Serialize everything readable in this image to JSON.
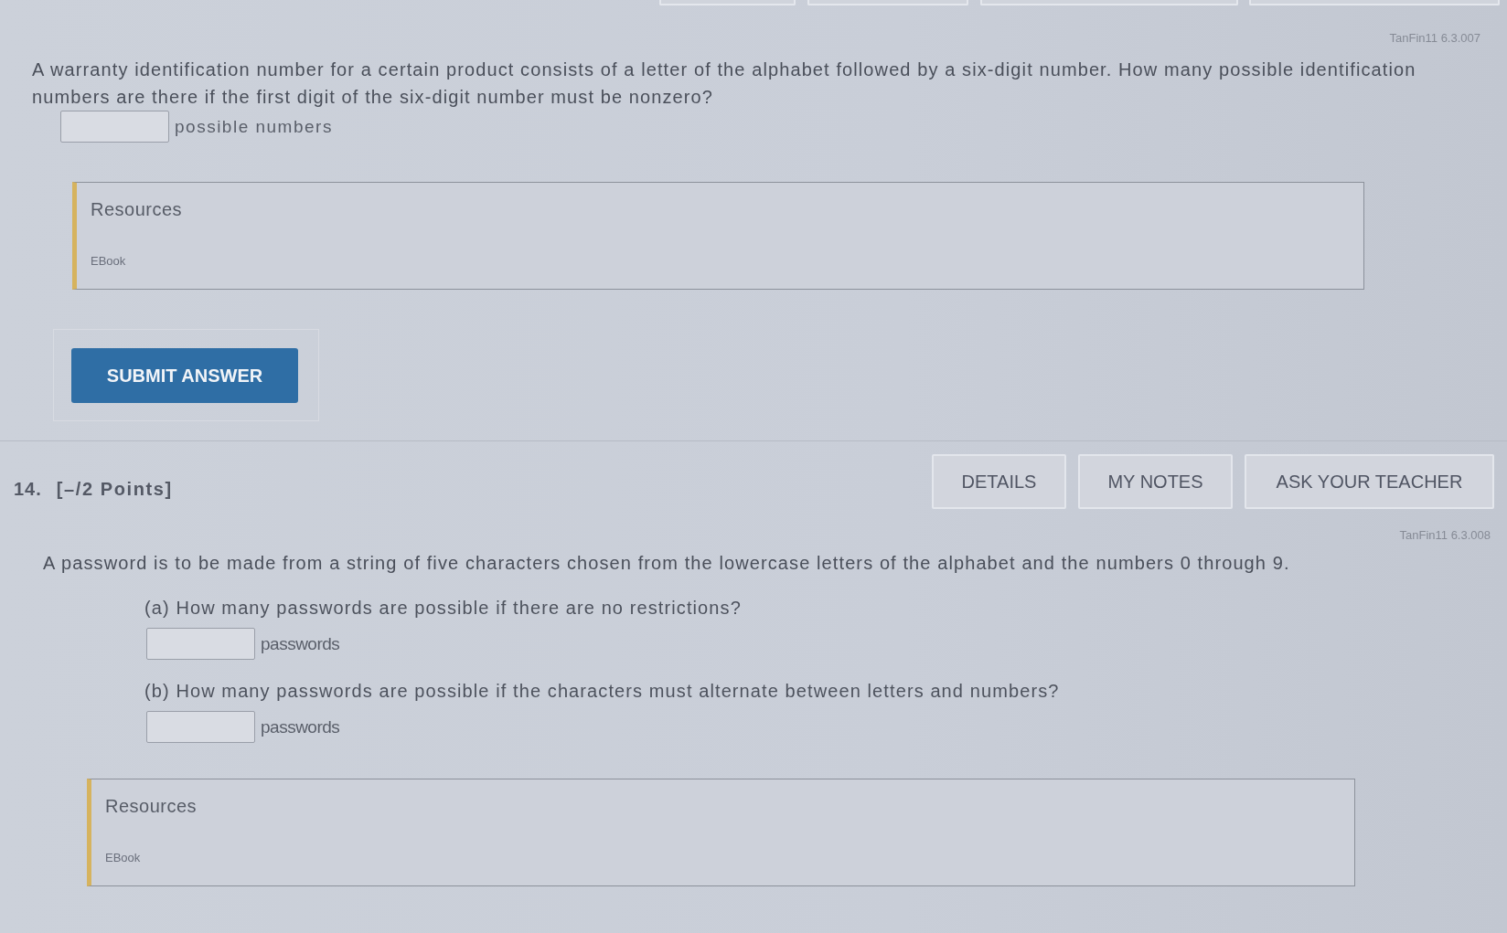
{
  "questions": [
    {
      "reference": "TanFin11 6.3.007",
      "prompt": "A warranty identification number for a certain product consists of a letter of the alphabet followed by a six-digit number. How many possible identification numbers are there if the first digit of the six-digit number must be nonzero?",
      "parts": [
        {
          "unit": "possible numbers"
        }
      ],
      "resources": {
        "title": "Resources",
        "links": [
          "EBook"
        ]
      },
      "submit_button": "SUBMIT ANSWER"
    },
    {
      "number": "14.",
      "points": "[–/2 Points]",
      "actions": [
        "DETAILS",
        "MY NOTES",
        "ASK YOUR TEACHER"
      ],
      "reference": "TanFin11 6.3.008",
      "prompt": "A password is to be made from a string of five characters chosen from the lowercase letters of the alphabet and the numbers 0 through 9.",
      "parts": [
        {
          "question": "(a) How many passwords are possible if there are no restrictions?",
          "unit": "passwords"
        },
        {
          "question": "(b) How many passwords are possible if the characters must alternate between letters and numbers?",
          "unit": "passwords"
        }
      ],
      "resources": {
        "title": "Resources",
        "links": [
          "EBook"
        ]
      }
    }
  ]
}
